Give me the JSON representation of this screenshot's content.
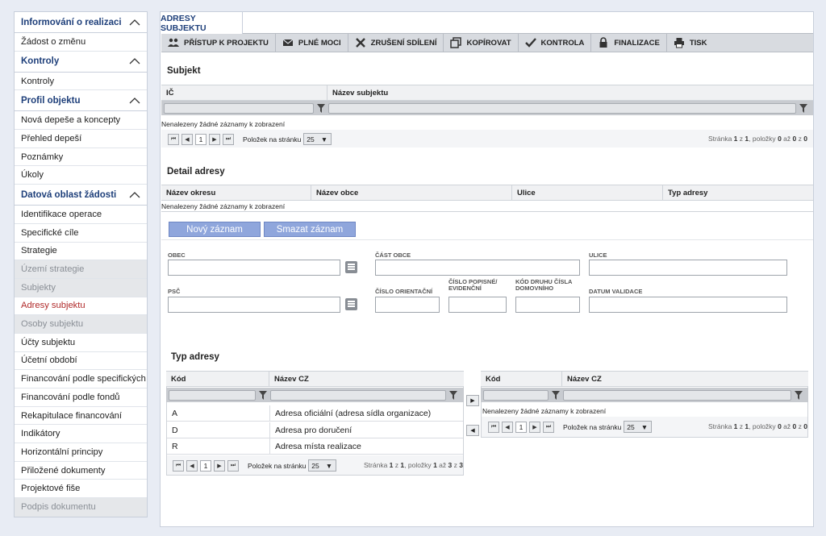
{
  "sidebar": {
    "groups": [
      {
        "title": "Informování o realizaci",
        "items": [
          {
            "label": "Žádost o změnu",
            "state": "normal"
          }
        ]
      },
      {
        "title": "Kontroly",
        "items": [
          {
            "label": "Kontroly",
            "state": "normal"
          }
        ]
      },
      {
        "title": "Profil objektu",
        "items": [
          {
            "label": "Nová depeše a koncepty",
            "state": "normal"
          },
          {
            "label": "Přehled depeší",
            "state": "normal"
          },
          {
            "label": "Poznámky",
            "state": "normal"
          },
          {
            "label": "Úkoly",
            "state": "normal"
          }
        ]
      },
      {
        "title": "Datová oblast žádosti",
        "items": [
          {
            "label": "Identifikace operace",
            "state": "normal"
          },
          {
            "label": "Specifické cíle",
            "state": "normal"
          },
          {
            "label": "Strategie",
            "state": "normal"
          },
          {
            "label": "Území strategie",
            "state": "disabled"
          },
          {
            "label": "Subjekty",
            "state": "disabled"
          },
          {
            "label": "Adresy subjektu",
            "state": "active"
          },
          {
            "label": "Osoby subjektu",
            "state": "disabled"
          },
          {
            "label": "Účty subjektu",
            "state": "normal"
          },
          {
            "label": "Účetní období",
            "state": "normal"
          },
          {
            "label": "Financování podle specifických cílů",
            "state": "normal"
          },
          {
            "label": "Financování podle fondů",
            "state": "normal"
          },
          {
            "label": "Rekapitulace financování",
            "state": "normal"
          },
          {
            "label": "Indikátory",
            "state": "normal"
          },
          {
            "label": "Horizontální principy",
            "state": "normal"
          },
          {
            "label": "Přiložené dokumenty",
            "state": "normal"
          },
          {
            "label": "Projektové fiše",
            "state": "normal"
          },
          {
            "label": "Podpis dokumentu",
            "state": "disabled"
          }
        ]
      }
    ]
  },
  "tab": {
    "label": "ADRESY SUBJEKTU"
  },
  "toolbar": {
    "buttons": [
      {
        "label": "PŘÍSTUP K PROJEKTU",
        "icon": "users-icon"
      },
      {
        "label": "PLNÉ MOCI",
        "icon": "envelope-icon"
      },
      {
        "label": "ZRUŠENÍ SDÍLENÍ",
        "icon": "cross-icon"
      },
      {
        "label": "KOPÍROVAT",
        "icon": "copy-icon"
      },
      {
        "label": "KONTROLA",
        "icon": "check-icon"
      },
      {
        "label": "FINALIZACE",
        "icon": "lock-icon"
      },
      {
        "label": "TISK",
        "icon": "printer-icon"
      }
    ]
  },
  "subjekt": {
    "title": "Subjekt",
    "columns": [
      "IČ",
      "Název subjektu"
    ],
    "empty": "Nenalezeny žádné záznamy k zobrazení",
    "pager": {
      "page": "1",
      "per_page_label": "Položek na stránku",
      "per_page": "25",
      "info_prefix": "Stránka",
      "page_cur": "1",
      "of": "z",
      "page_total": "1",
      "items_label": ", položky",
      "from": "0",
      "to_word": "až",
      "to": "0",
      "total_word": "z",
      "total": "0"
    }
  },
  "detail": {
    "title": "Detail adresy",
    "columns": [
      "Název okresu",
      "Název obce",
      "Ulice",
      "Typ adresy"
    ],
    "empty": "Nenalezeny žádné záznamy k zobrazení",
    "new_button": "Nový záznam",
    "delete_button": "Smazat záznam"
  },
  "form": {
    "obec": "OBEC",
    "cast_obce": "ČÁST OBCE",
    "ulice": "ULICE",
    "psc": "PSČ",
    "cislo_orientacni": "ČÍSLO ORIENTAČNÍ",
    "cislo_popisne_1": "ČÍSLO POPISNÉ/",
    "cislo_popisne_2": "EVIDENČNÍ",
    "kod_druhu_1": "KÓD DRUHU ČÍSLA",
    "kod_druhu_2": "DOMOVNÍHO",
    "datum_validace": "DATUM VALIDACE"
  },
  "typ_adresy": {
    "title": "Typ adresy",
    "columns": [
      "Kód",
      "Název CZ"
    ],
    "rows": [
      {
        "kod": "A",
        "nazev": "Adresa oficiální (adresa sídla organizace)"
      },
      {
        "kod": "D",
        "nazev": "Adresa pro doručení"
      },
      {
        "kod": "R",
        "nazev": "Adresa místa realizace"
      }
    ],
    "left_pager": {
      "page": "1",
      "per_page_label": "Položek na stránku",
      "per_page": "25",
      "info_prefix": "Stránka",
      "page_cur": "1",
      "of": "z",
      "page_total": "1",
      "items_label": ", položky",
      "from": "1",
      "to_word": "až",
      "to": "3",
      "total_word": "z",
      "total": "3"
    },
    "right_empty": "Nenalezeny žádné záznamy k zobrazení",
    "right_pager": {
      "page": "1",
      "per_page_label": "Položek na stránku",
      "per_page": "25",
      "info_prefix": "Stránka",
      "page_cur": "1",
      "of": "z",
      "page_total": "1",
      "items_label": ", položky",
      "from": "0",
      "to_word": "až",
      "to": "0",
      "total_word": "z",
      "total": "0"
    }
  }
}
